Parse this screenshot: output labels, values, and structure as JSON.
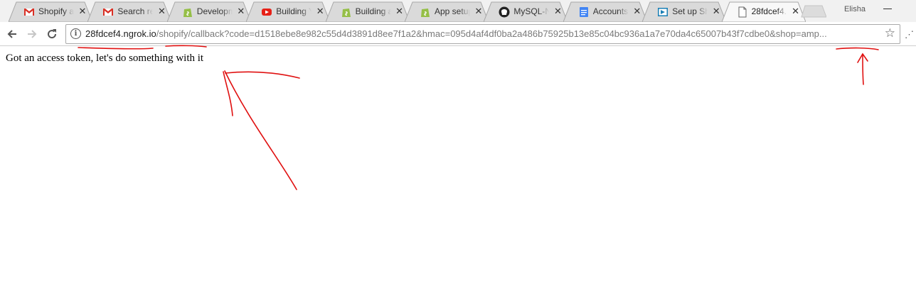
{
  "tabs": [
    {
      "title": "Shopify ap",
      "icon": "gmail-icon"
    },
    {
      "title": "Search res",
      "icon": "gmail-icon"
    },
    {
      "title": "Developm",
      "icon": "shopify-icon"
    },
    {
      "title": "Building Y",
      "icon": "youtube-icon"
    },
    {
      "title": "Building a",
      "icon": "shopify-icon"
    },
    {
      "title": "App setup",
      "icon": "shopify-icon"
    },
    {
      "title": "MySQL-N",
      "icon": "github-icon"
    },
    {
      "title": "Accounts",
      "icon": "google-docs-icon"
    },
    {
      "title": "Set up Sh",
      "icon": "site-icon"
    },
    {
      "title": "28fdcef4.",
      "icon": "page-icon",
      "active": true
    }
  ],
  "profile": "Elisha",
  "address_bar": {
    "host": "28fdcef4.ngrok.io",
    "path": "/shopify/callback?code=d1518ebe8e982c55d4d3891d8ee7f1a2&hmac=095d4af4df0ba2a486b75925b13e85c04bc936a1a7e70da4c65007b43f7cdbe0&shop=amp..."
  },
  "page": {
    "message": "Got an access token, let's do something with it"
  },
  "annotation_color": "#e01010"
}
